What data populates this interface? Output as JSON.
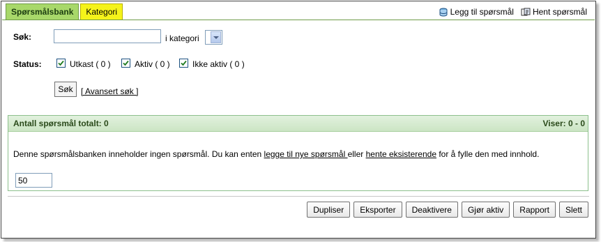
{
  "tabs": [
    {
      "label": "Spørsmålsbank",
      "active": true
    },
    {
      "label": "Kategori",
      "active": false
    }
  ],
  "top_actions": {
    "add_label": "Legg til spørsmål",
    "fetch_label": "Hent spørsmål"
  },
  "search": {
    "label": "Søk:",
    "value": "",
    "in_category_label": "i kategori",
    "category_selected": ""
  },
  "status": {
    "label": "Status:",
    "options": [
      {
        "label": "Utkast ( 0 )",
        "checked": true
      },
      {
        "label": "Aktiv ( 0 )",
        "checked": true
      },
      {
        "label": "Ikke aktiv ( 0 )",
        "checked": true
      }
    ]
  },
  "search_button": "Søk",
  "advanced_search": "[ Avansert søk ]",
  "results": {
    "total_label": "Antall spørsmål totalt: 0",
    "showing_label": "Viser: 0 - 0",
    "message_prefix": "Denne spørsmålsbanken inneholder ingen spørsmål. Du kan enten ",
    "link_add": "legge til nye spørsmål ",
    "message_mid": "eller ",
    "link_fetch": "hente eksisterende",
    "message_suffix": " for å fylle den med innhold.",
    "per_page": "50"
  },
  "buttons": {
    "duplicate": "Dupliser",
    "export": "Eksporter",
    "deactivate": "Deaktivere",
    "activate": "Gjør aktiv",
    "report": "Rapport",
    "delete": "Slett"
  },
  "colors": {
    "tab_active": "#a8d86a",
    "tab_inactive": "#f5f31a",
    "panel_header": "#cce5c4"
  }
}
